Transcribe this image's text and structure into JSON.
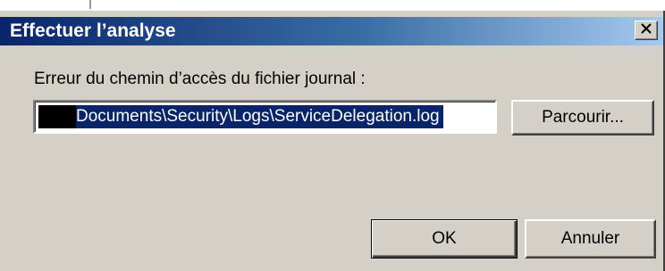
{
  "window": {
    "title": "Effectuer l’analyse",
    "close_icon": "close-icon"
  },
  "form": {
    "label": "Erreur du chemin d’accès du fichier journal :",
    "path_value": "Documents\\Security\\Logs\\ServiceDelegation.log"
  },
  "buttons": {
    "browse": "Parcourir...",
    "ok": "OK",
    "cancel": "Annuler"
  },
  "colors": {
    "title_gradient_start": "#0a246a",
    "title_gradient_end": "#a6caf0",
    "dialog_face": "#d4d0c8",
    "selection": "#0a246a"
  }
}
